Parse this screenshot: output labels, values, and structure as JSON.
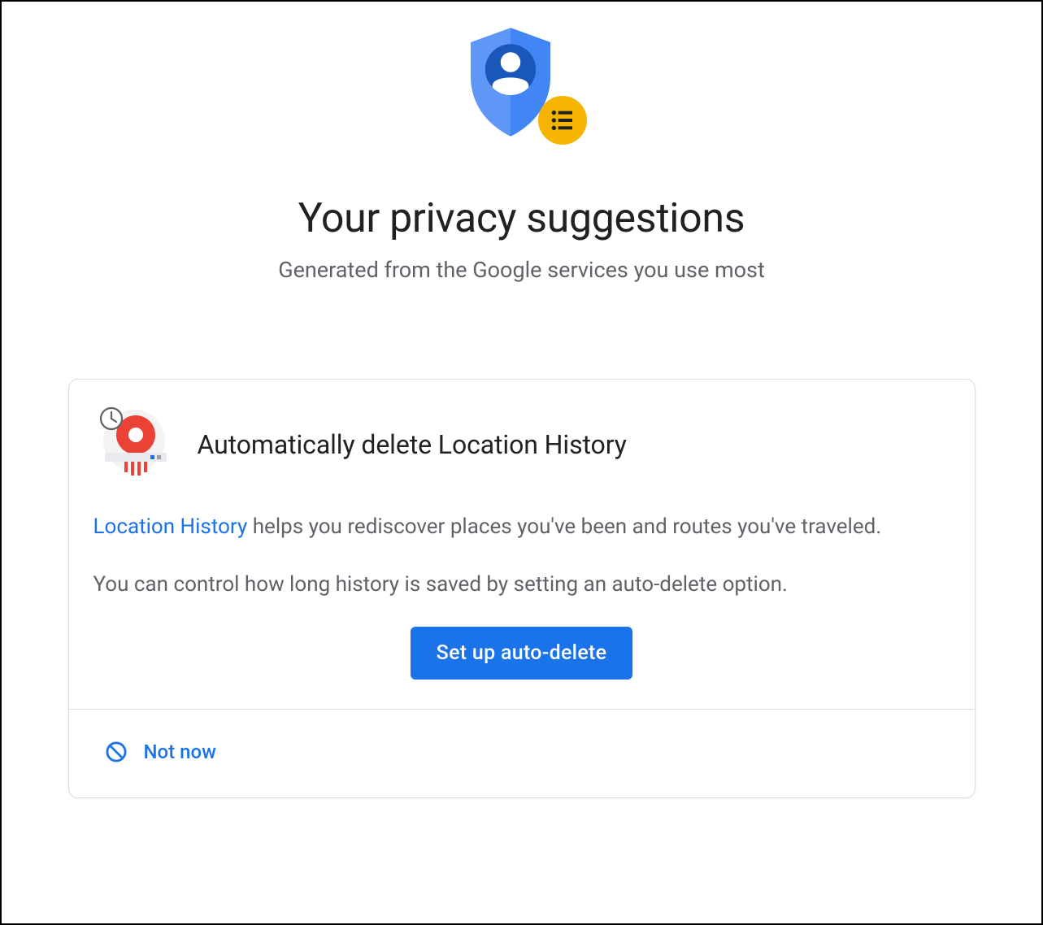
{
  "header": {
    "title": "Your privacy suggestions",
    "subtitle": "Generated from the Google services you use most"
  },
  "card": {
    "title": "Automatically delete Location History",
    "linkText": "Location History",
    "line1_suffix": " helps you rediscover places you've been and routes you've traveled.",
    "line2": "You can control how long history is saved by setting an auto-delete option.",
    "primaryButton": "Set up auto-delete",
    "footerButton": "Not now"
  }
}
